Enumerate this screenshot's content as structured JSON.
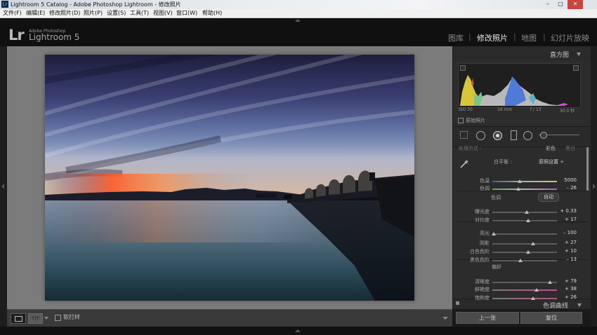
{
  "window": {
    "title": "Lightroom 5 Catalog - Adobe Photoshop Lightroom - 修改照片",
    "app_icon": "Lr",
    "controls": [
      "–",
      "□",
      "✕"
    ]
  },
  "menu": [
    "文件(F)",
    "编辑(E)",
    "修改照片(D)",
    "照片(P)",
    "设置(S)",
    "工具(T)",
    "视图(V)",
    "窗口(W)",
    "帮助(H)"
  ],
  "identity": {
    "logo": "Lr",
    "brand": "Adobe Photoshop",
    "product": "Lightroom 5"
  },
  "modules": [
    "图库",
    "修改照片",
    "地图",
    "幻灯片放映"
  ],
  "active_module": "修改照片",
  "histogram": {
    "title": "直方图",
    "iso": "ISO 50",
    "focal": "16 mm",
    "aperture": "f / 13",
    "shutter": "30.0 秒",
    "original_photo_label": "原始照片"
  },
  "basic": {
    "partial_header_left": "处理方式 :",
    "partial_header_right": "彩色",
    "partial_header_right2": "黑白",
    "wb_label": "白平衡 :",
    "wb_value": "原照设置 ÷",
    "tone_label": "色调",
    "auto_label": "自动",
    "presence_label": "偏好",
    "sliders": [
      {
        "label": "色温",
        "value": "5000",
        "pos": 0.42,
        "track": "temp"
      },
      {
        "label": "色调",
        "value": "– 26",
        "pos": 0.4,
        "track": "tint"
      },
      {
        "label": "曝光度",
        "value": "+ 0.33",
        "pos": 0.53,
        "track": "plain"
      },
      {
        "label": "对比度",
        "value": "+ 17",
        "pos": 0.55,
        "track": "plain"
      },
      {
        "label": "高光",
        "value": "– 100",
        "pos": 0.02,
        "track": "plain"
      },
      {
        "label": "阴影",
        "value": "+ 27",
        "pos": 0.63,
        "track": "plain"
      },
      {
        "label": "白色色阶",
        "value": "+ 10",
        "pos": 0.55,
        "track": "plain"
      },
      {
        "label": "黑色色阶",
        "value": "– 13",
        "pos": 0.44,
        "track": "plain"
      },
      {
        "label": "清晰度",
        "value": "+ 79",
        "pos": 0.89,
        "track": "plain"
      },
      {
        "label": "鲜艳度",
        "value": "+ 38",
        "pos": 0.69,
        "track": "vib"
      },
      {
        "label": "饱和度",
        "value": "+ 26",
        "pos": 0.63,
        "track": "sat"
      }
    ]
  },
  "next_panel": "色调曲线",
  "buttons": {
    "previous": "上一张",
    "reset": "复位"
  },
  "toolbar": {
    "yy_label": "Y|Y",
    "softproof_label": "软打样"
  },
  "colors": {
    "accent_text": "#d0d0d0",
    "panel_bg": "#2c2c2c",
    "center_bg": "#7b7b7b"
  }
}
